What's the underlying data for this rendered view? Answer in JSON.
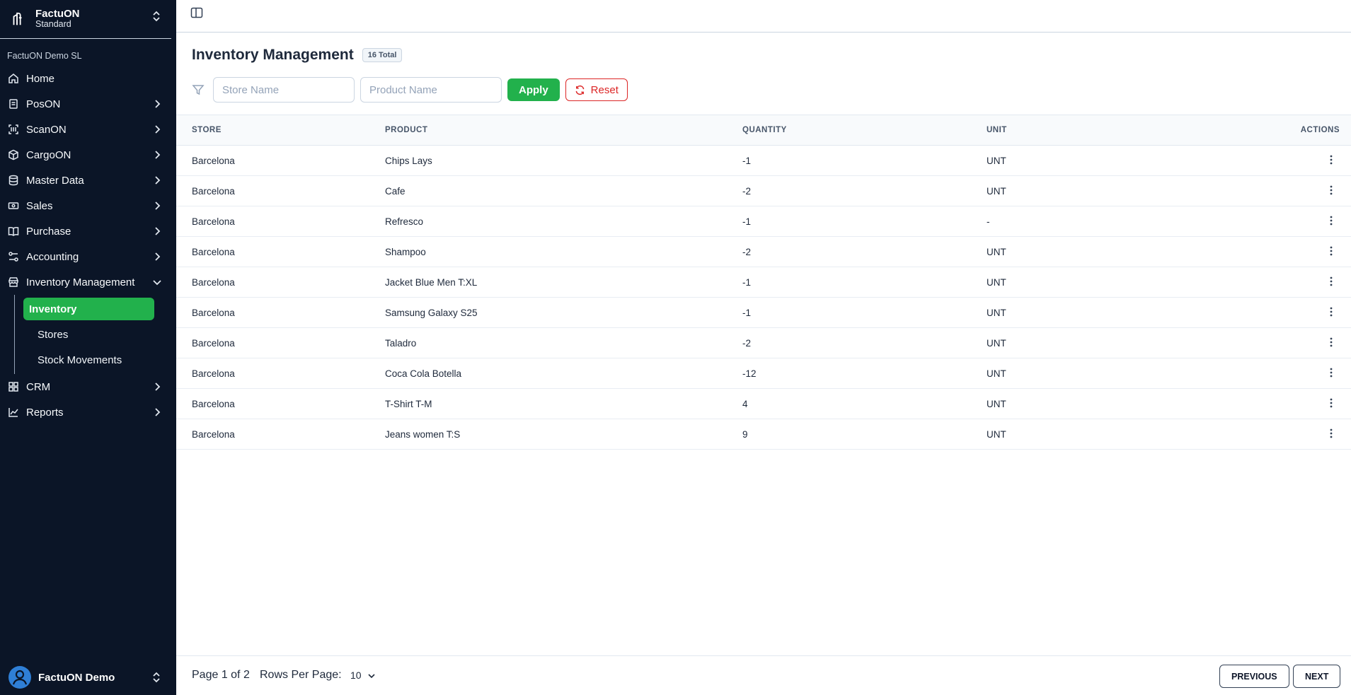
{
  "brand": {
    "name": "FactuON",
    "plan": "Standard",
    "org": "FactuON Demo SL"
  },
  "sidebar": {
    "items": [
      {
        "label": "Home",
        "icon": "home-icon"
      },
      {
        "label": "PosON",
        "icon": "receipt-icon"
      },
      {
        "label": "ScanON",
        "icon": "barcode-scan-icon"
      },
      {
        "label": "CargoON",
        "icon": "package-icon"
      },
      {
        "label": "Master Data",
        "icon": "database-icon"
      },
      {
        "label": "Sales",
        "icon": "banknote-icon"
      },
      {
        "label": "Purchase",
        "icon": "book-icon"
      },
      {
        "label": "Accounting",
        "icon": "sliders-icon"
      },
      {
        "label": "Inventory Management",
        "icon": "store-icon"
      },
      {
        "label": "CRM",
        "icon": "grid-icon"
      },
      {
        "label": "Reports",
        "icon": "chart-line-icon"
      }
    ],
    "subitems": [
      {
        "label": "Inventory",
        "active": true
      },
      {
        "label": "Stores",
        "active": false
      },
      {
        "label": "Stock Movements",
        "active": false
      }
    ],
    "user": "FactuON Demo"
  },
  "header": {
    "title": "Inventory Management",
    "total_badge": "16 Total"
  },
  "filters": {
    "store_placeholder": "Store Name",
    "product_placeholder": "Product Name",
    "apply_label": "Apply",
    "reset_label": "Reset"
  },
  "table": {
    "columns": [
      "STORE",
      "PRODUCT",
      "QUANTITY",
      "UNIT",
      "ACTIONS"
    ],
    "rows": [
      {
        "store": "Barcelona",
        "product": "Chips Lays",
        "quantity": "-1",
        "unit": "UNT"
      },
      {
        "store": "Barcelona",
        "product": "Cafe",
        "quantity": "-2",
        "unit": "UNT"
      },
      {
        "store": "Barcelona",
        "product": "Refresco",
        "quantity": "-1",
        "unit": "-"
      },
      {
        "store": "Barcelona",
        "product": "Shampoo",
        "quantity": "-2",
        "unit": "UNT"
      },
      {
        "store": "Barcelona",
        "product": "Jacket Blue Men T:XL",
        "quantity": "-1",
        "unit": "UNT"
      },
      {
        "store": "Barcelona",
        "product": "Samsung Galaxy S25",
        "quantity": "-1",
        "unit": "UNT"
      },
      {
        "store": "Barcelona",
        "product": "Taladro",
        "quantity": "-2",
        "unit": "UNT"
      },
      {
        "store": "Barcelona",
        "product": "Coca Cola Botella",
        "quantity": "-12",
        "unit": "UNT"
      },
      {
        "store": "Barcelona",
        "product": "T-Shirt T-M",
        "quantity": "4",
        "unit": "UNT"
      },
      {
        "store": "Barcelona",
        "product": "Jeans women T:S",
        "quantity": "9",
        "unit": "UNT"
      }
    ]
  },
  "pagination": {
    "page_info": "Page 1 of 2",
    "rows_label": "Rows Per Page:",
    "rows_value": "10",
    "previous_label": "PREVIOUS",
    "next_label": "NEXT"
  },
  "colors": {
    "sidebar_bg": "#0b1527",
    "accent_green": "#22b14c",
    "danger_red": "#dc2626"
  }
}
